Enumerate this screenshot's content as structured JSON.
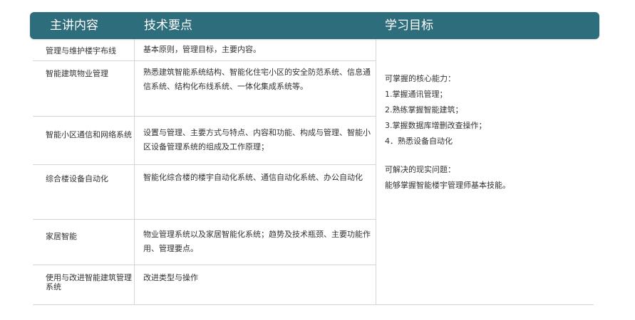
{
  "header": {
    "col1": "主讲内容",
    "col2": "技术要点",
    "col3": "学习目标"
  },
  "rows": [
    {
      "topic": "管理与维护楼宇布线",
      "point": "基本原则，管理目标，主要内容。"
    },
    {
      "topic": "智能建筑物业管理",
      "point": "熟悉建筑智能系统结构、智能化住宅小区的安全防范系统、信息通信系统、结构化布线系统、一体化集成系统等。"
    },
    {
      "topic": "智能小区通信和网络系统",
      "point": "设置与管理、主要方式与特点、内容和功能、构成与管理、智能小区设备管理系统的组成及工作原理；"
    },
    {
      "topic": "综合楼设备自动化",
      "point": "智能化综合楼的楼宇自动化系统、通信自动化系统、办公自动化"
    },
    {
      "topic": "家居智能",
      "point": "物业管理系统以及家居智能化系统；趋势及技术瓶颈、主要功能作用、管理要点。"
    },
    {
      "topic": "使用与改进智能建筑管理系统",
      "point": "改进类型与操作"
    }
  ],
  "goals": {
    "core_title": "可掌握的核心能力：",
    "core_items": [
      "1.掌握通讯管理；",
      "2.熟练掌握智能建筑；",
      "3.掌握数据库增删改查操作；",
      "4．熟悉设备自动化"
    ],
    "problem_title": "可解决的现实问题：",
    "problem_text": "能够掌握智能楼宇管理师基本技能。"
  }
}
